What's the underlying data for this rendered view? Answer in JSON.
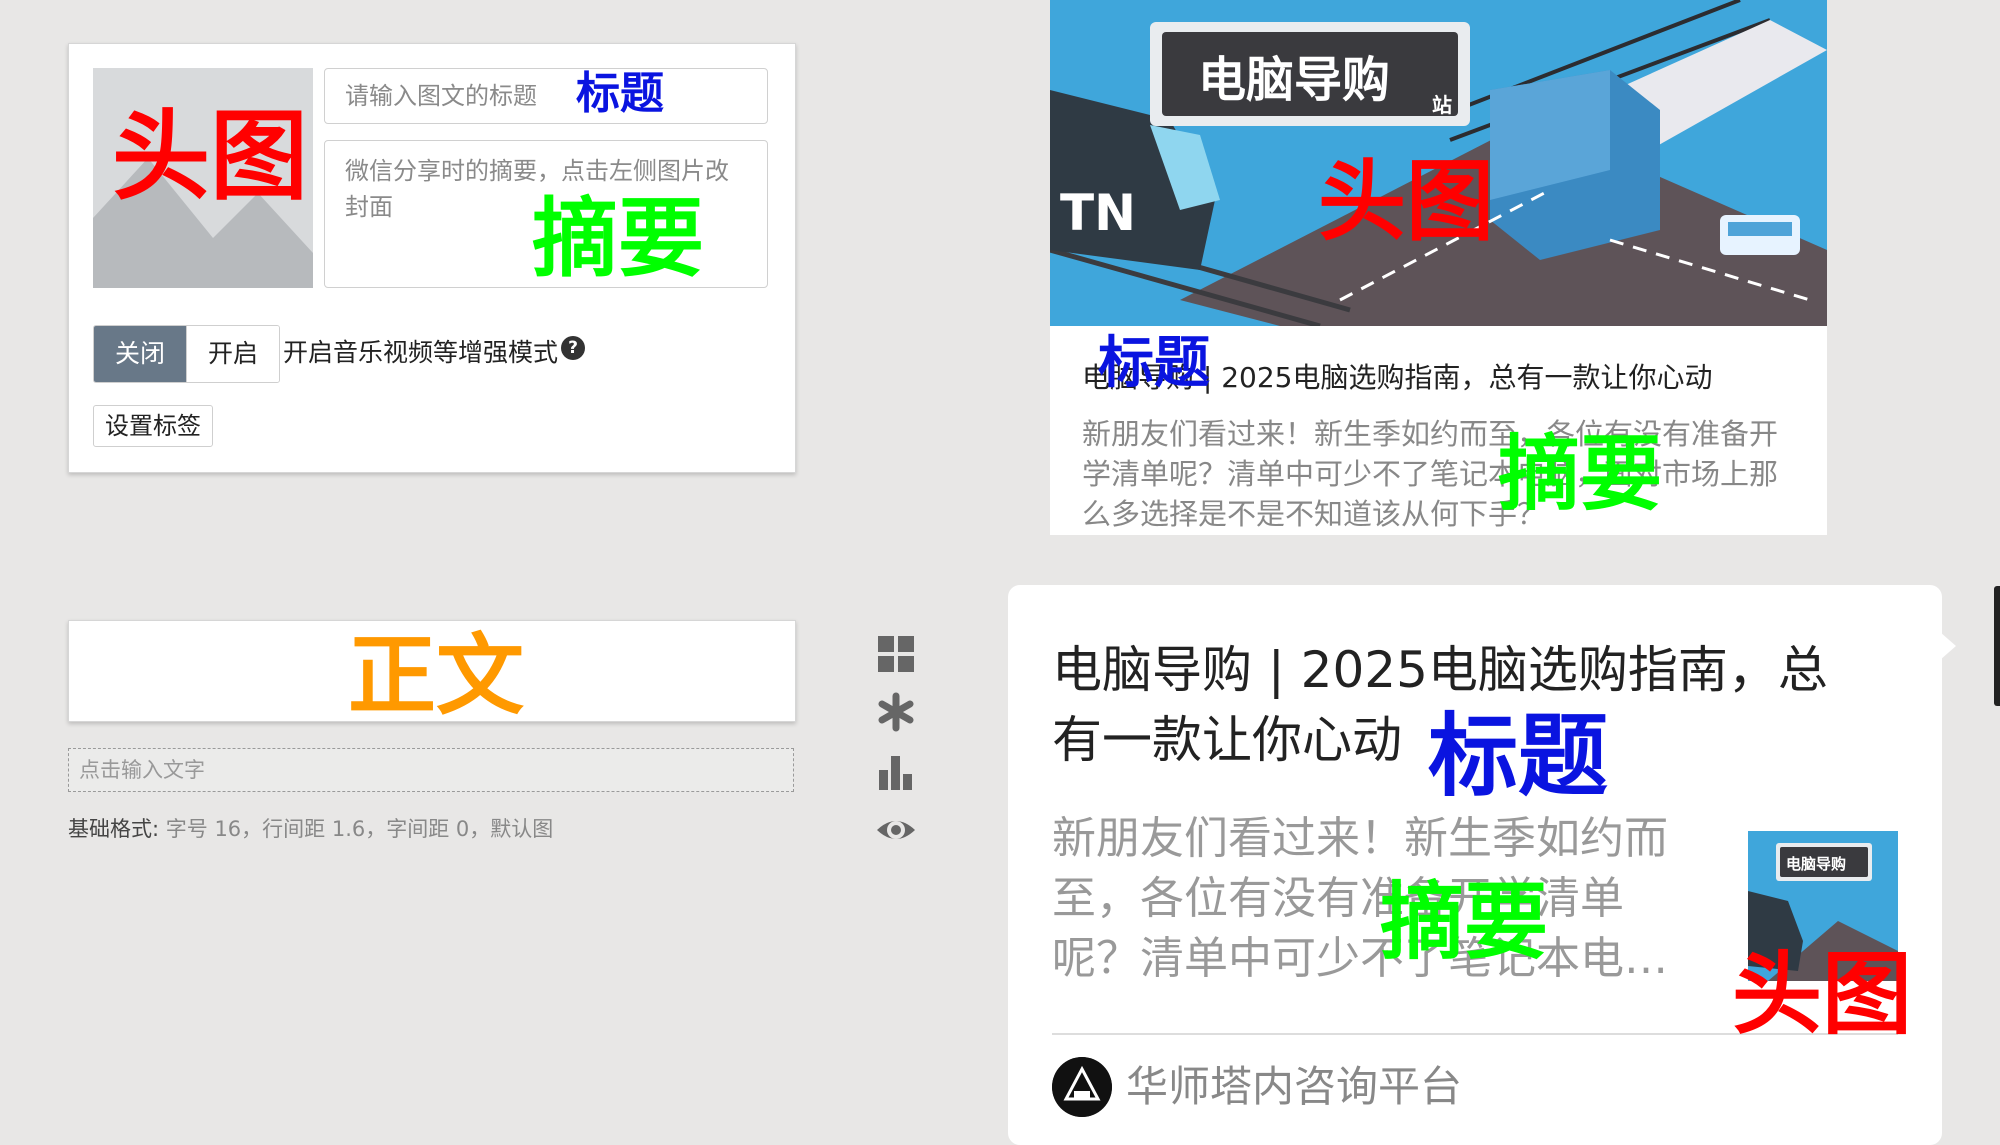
{
  "editor": {
    "title_placeholder": "请输入图文的标题",
    "summary_placeholder": "微信分享时的摘要，点击左侧图片改封面",
    "toggle_off": "关闭",
    "toggle_on": "开启",
    "enhanced_mode_label": "开启音乐视频等增强模式",
    "help_icon": "?",
    "tag_button": "设置标签"
  },
  "body_editor": {
    "text_placeholder": "点击输入文字",
    "format_label": "基础格式:",
    "format_value": "字号 16，行间距 1.6，字间距 0，默认图"
  },
  "toolbar": {
    "icons": [
      "grid-icon",
      "asterisk-icon",
      "bar-chart-icon",
      "eye-icon"
    ]
  },
  "annotations": {
    "head_image": "头图",
    "title": "标题",
    "summary": "摘要",
    "body": "正文"
  },
  "preview_article": {
    "hero_sign": "电脑导购",
    "hero_sign_small": "站",
    "title": "电脑导购 | 2025电脑选购指南，总有一款让你心动",
    "summary": "新朋友们看过来！新生季如约而至，各位有没有准备开学清单呢？清单中可少不了笔记本电脑，面对市场上那么多选择是不是不知道该从何下手？"
  },
  "preview_share": {
    "title": "电脑导购 | 2025电脑选购指南，总有一款让你心动",
    "summary": "新朋友们看过来！新生季如约而至，各位有没有准备开学清单呢？清单中可少不了笔记本电…",
    "thumb_sign": "电脑导购",
    "account_name": "华师塔内咨询平台"
  },
  "colors": {
    "annotation_red": "#ff0000",
    "annotation_blue": "#0a14e0",
    "annotation_green": "#00ff00",
    "annotation_orange": "#ff9900",
    "toggle_active": "#687888"
  }
}
